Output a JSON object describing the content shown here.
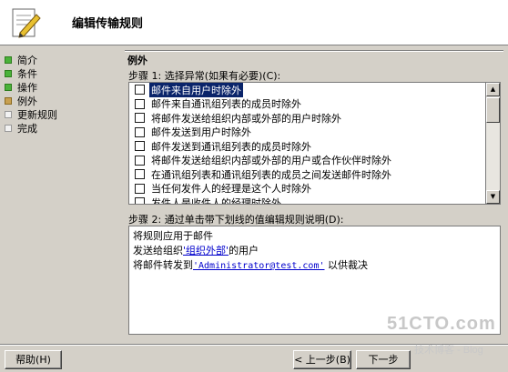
{
  "header": {
    "title": "编辑传输规则",
    "icon": "document-pencil-icon"
  },
  "nav": {
    "items": [
      {
        "label": "简介",
        "state": "done"
      },
      {
        "label": "条件",
        "state": "done"
      },
      {
        "label": "操作",
        "state": "done"
      },
      {
        "label": "例外",
        "state": "current"
      },
      {
        "label": "更新规则",
        "state": "pending"
      },
      {
        "label": "完成",
        "state": "pending"
      }
    ]
  },
  "section": {
    "title": "例外",
    "step1_label": "步骤 1: 选择异常(如果有必要)(C):",
    "step2_label": "步骤 2: 通过单击带下划线的值编辑规则说明(D):"
  },
  "exceptions": [
    {
      "label": "邮件来自用户时除外",
      "checked": false,
      "selected": true
    },
    {
      "label": "邮件来自通讯组列表的成员时除外",
      "checked": false,
      "selected": false
    },
    {
      "label": "将邮件发送给组织内部或外部的用户时除外",
      "checked": false,
      "selected": false
    },
    {
      "label": "邮件发送到用户时除外",
      "checked": false,
      "selected": false
    },
    {
      "label": "邮件发送到通讯组列表的成员时除外",
      "checked": false,
      "selected": false
    },
    {
      "label": "将邮件发送给组织内部或外部的用户或合作伙伴时除外",
      "checked": false,
      "selected": false
    },
    {
      "label": "在通讯组列表和通讯组列表的成员之间发送邮件时除外",
      "checked": false,
      "selected": false
    },
    {
      "label": "当任何发件人的经理是这个人时除外",
      "checked": false,
      "selected": false
    },
    {
      "label": "发件人是收件人的经理时除外",
      "checked": false,
      "selected": false
    }
  ],
  "description": {
    "line1": "将规则应用于邮件",
    "line2_prefix": "发送给组织",
    "line2_link": "'组织外部'",
    "line2_suffix": "的用户",
    "line3_prefix": "将邮件转发到",
    "line3_link": "'Administrator@test.com'",
    "line3_suffix": "以供裁决"
  },
  "buttons": {
    "help": "帮助(H)",
    "back": "< 上一步(B)",
    "next": "下一步"
  },
  "watermark": {
    "site": "51CTO.com",
    "blog": "技术博客",
    "blog_suffix": "Blog"
  },
  "colors": {
    "selection": "#0a246a",
    "link": "#0000cc",
    "done": "#4ab23a"
  }
}
